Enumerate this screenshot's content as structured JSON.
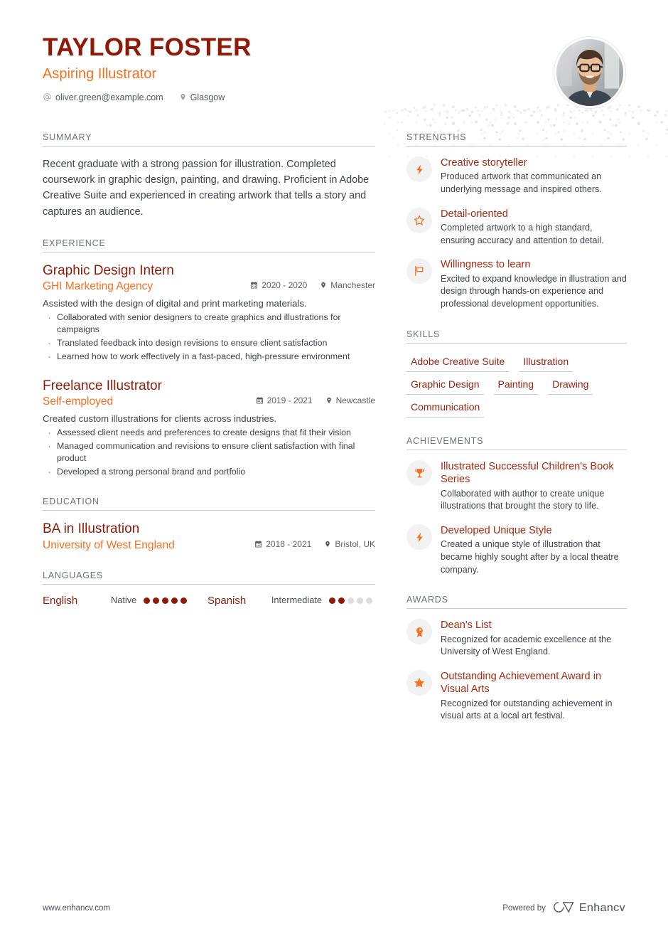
{
  "header": {
    "name": "TAYLOR FOSTER",
    "role": "Aspiring Illustrator",
    "email": "oliver.green@example.com",
    "location": "Glasgow",
    "email_icon": "at-icon",
    "location_icon": "map-pin-icon",
    "photo_alt": "profile-photo"
  },
  "colors": {
    "dark_red": "#8f1a08",
    "orange": "#f4711f",
    "title_red": "#a82a11",
    "gray_text": "#3f4449",
    "section_label": "#6c7378",
    "divider": "#c9ccce",
    "icon_circle_bg": "#f2f2f2",
    "dot_empty": "#dcdcdc"
  },
  "sections": {
    "summary_label": "SUMMARY",
    "experience_label": "EXPERIENCE",
    "education_label": "EDUCATION",
    "languages_label": "LANGUAGES",
    "strengths_label": "STRENGTHS",
    "skills_label": "SKILLS",
    "achievements_label": "ACHIEVEMENTS",
    "awards_label": "AWARDS"
  },
  "summary": {
    "text": "Recent graduate with a strong passion for illustration. Completed coursework in graphic design, painting, and drawing. Proficient in Adobe Creative Suite and experienced in creating artwork that tells a story and captures an audience."
  },
  "experience": [
    {
      "title": "Graphic Design Intern",
      "org": "GHI Marketing Agency",
      "dates": "2020 - 2020",
      "location": "Manchester",
      "desc": "Assisted with the design of digital and print marketing materials.",
      "bullets": [
        "Collaborated with senior designers to create graphics and illustrations for campaigns",
        "Translated feedback into design revisions to ensure client satisfaction",
        "Learned how to work effectively in a fast-paced, high-pressure environment"
      ]
    },
    {
      "title": "Freelance Illustrator",
      "org": "Self-employed",
      "dates": "2019 - 2021",
      "location": "Newcastle",
      "desc": "Created custom illustrations for clients across industries.",
      "bullets": [
        "Assessed client needs and preferences to create designs that fit their vision",
        "Managed communication and revisions to ensure client satisfaction with final product",
        "Developed a strong personal brand and portfolio"
      ]
    }
  ],
  "education": [
    {
      "title": "BA in Illustration",
      "org": "University of West England",
      "dates": "2018 - 2021",
      "location": "Bristol, UK"
    }
  ],
  "languages": [
    {
      "name": "English",
      "level": "Native",
      "filled": 5,
      "total": 5
    },
    {
      "name": "Spanish",
      "level": "Intermediate",
      "filled": 2,
      "total": 5
    }
  ],
  "strengths": [
    {
      "icon": "lightning-bolt-icon",
      "title": "Creative storyteller",
      "desc": "Produced artwork that communicated an underlying message and inspired others."
    },
    {
      "icon": "star-outline-icon",
      "title": "Detail-oriented",
      "desc": "Completed artwork to a high standard, ensuring accuracy and attention to detail."
    },
    {
      "icon": "flag-icon",
      "title": "Willingness to learn",
      "desc": "Excited to expand knowledge in illustration and design through hands-on experience and professional development opportunities."
    }
  ],
  "skills": [
    "Adobe Creative Suite",
    "Illustration",
    "Graphic Design",
    "Painting",
    "Drawing",
    "Communication"
  ],
  "achievements": [
    {
      "icon": "trophy-icon",
      "title": "Illustrated Successful Children's Book Series",
      "desc": "Collaborated with author to create unique illustrations that brought the story to life."
    },
    {
      "icon": "lightning-bolt-icon",
      "title": "Developed Unique Style",
      "desc": "Created a unique style of illustration that became highly sought after by a local theatre company."
    }
  ],
  "awards": [
    {
      "icon": "award-medal-icon",
      "title": "Dean's List",
      "desc": "Recognized for academic excellence at the University of West England."
    },
    {
      "icon": "star-filled-icon",
      "title": "Outstanding Achievement Award in Visual Arts",
      "desc": "Recognized for outstanding achievement in visual arts at a local art festival."
    }
  ],
  "footer": {
    "website": "www.enhancv.com",
    "powered_by": "Powered by",
    "brand": "Enhancv"
  }
}
